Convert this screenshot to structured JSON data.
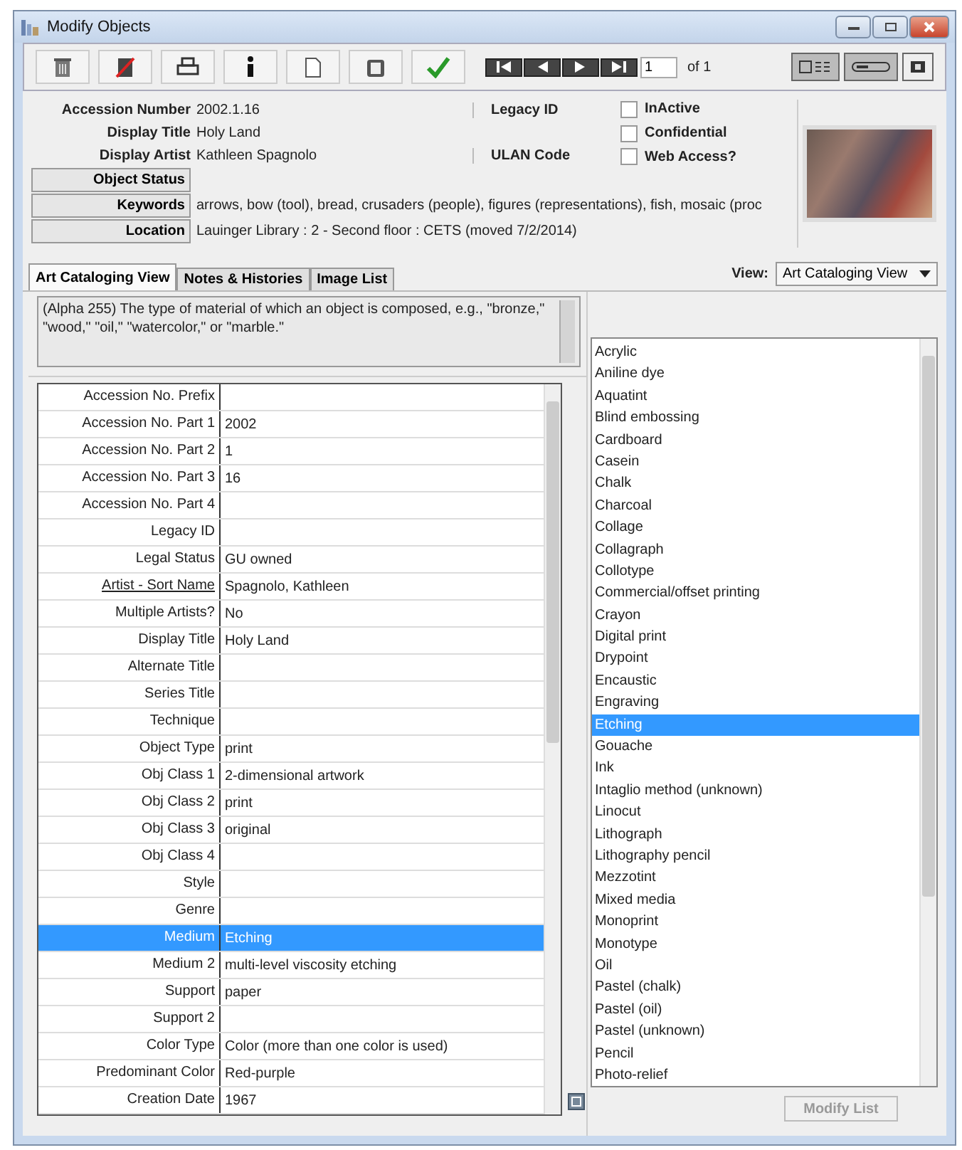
{
  "window": {
    "title": "Modify Objects"
  },
  "pager": {
    "page": "1",
    "of": "of 1"
  },
  "header": {
    "fields": [
      {
        "label": "Accession Number",
        "value": "2002.1.16"
      },
      {
        "label": "Display Title",
        "value": "Holy Land"
      },
      {
        "label": "Display Artist",
        "value": "Kathleen Spagnolo"
      }
    ],
    "side_fields": [
      {
        "label": "Legacy ID"
      },
      {
        "label": "ULAN Code"
      }
    ],
    "checkboxes": [
      {
        "label": "InActive",
        "checked": false
      },
      {
        "label": "Confidential",
        "checked": false
      },
      {
        "label": "Web Access?",
        "checked": false
      }
    ],
    "button_fields": [
      {
        "label": "Object Status"
      },
      {
        "label": "Keywords",
        "value": "arrows, bow (tool), bread, crusaders (people), figures (representations), fish, mosaic (proc"
      },
      {
        "label": "Location",
        "value": "Lauinger Library : 2 - Second floor : CETS (moved 7/2/2014)"
      }
    ]
  },
  "tabs": [
    {
      "label": "Art Cataloging View",
      "selected": true
    },
    {
      "label": "Notes & Histories",
      "selected": false
    },
    {
      "label": "Image List",
      "selected": false
    }
  ],
  "view": {
    "label": "View:",
    "value": "Art Cataloging View"
  },
  "description": "(Alpha 255) The type of material of which an object is composed, e.g., \"bronze,\" \"wood,\" \"oil,\" \"watercolor,\" or \"marble.\"",
  "table": {
    "rows": [
      {
        "label": "Accession No. Prefix",
        "link": false,
        "selected": false
      },
      {
        "label": "Accession No. Part 1",
        "value": "2002",
        "link": false,
        "selected": false
      },
      {
        "label": "Accession No. Part 2",
        "value": "1",
        "link": false,
        "selected": false
      },
      {
        "label": "Accession No. Part 3",
        "value": "16",
        "link": false,
        "selected": false
      },
      {
        "label": "Accession No. Part 4",
        "link": false,
        "selected": false
      },
      {
        "label": "Legacy ID",
        "link": false,
        "selected": false
      },
      {
        "label": "Legal Status",
        "value": "GU owned",
        "link": false,
        "selected": false
      },
      {
        "label": "Artist - Sort Name",
        "value": "Spagnolo, Kathleen",
        "link": true,
        "selected": false
      },
      {
        "label": "Multiple Artists?",
        "value": "No",
        "link": false,
        "selected": false
      },
      {
        "label": "Display Title",
        "value": "Holy Land",
        "link": false,
        "selected": false
      },
      {
        "label": "Alternate Title",
        "link": false,
        "selected": false
      },
      {
        "label": "Series Title",
        "link": false,
        "selected": false
      },
      {
        "label": "Technique",
        "link": false,
        "selected": false
      },
      {
        "label": "Object Type",
        "value": "print",
        "link": false,
        "selected": false
      },
      {
        "label": "Obj Class 1",
        "value": "2-dimensional artwork",
        "link": false,
        "selected": false
      },
      {
        "label": "Obj Class 2",
        "value": "print",
        "link": false,
        "selected": false
      },
      {
        "label": "Obj Class 3",
        "value": "original",
        "link": false,
        "selected": false
      },
      {
        "label": "Obj Class 4",
        "link": false,
        "selected": false
      },
      {
        "label": "Style",
        "link": false,
        "selected": false
      },
      {
        "label": "Genre",
        "link": false,
        "selected": false
      },
      {
        "label": "Medium",
        "value": "Etching",
        "link": false,
        "selected": true
      },
      {
        "label": "Medium 2",
        "value": "multi-level viscosity etching",
        "link": false,
        "selected": false
      },
      {
        "label": "Support",
        "value": "paper",
        "link": false,
        "selected": false
      },
      {
        "label": "Support 2",
        "link": false,
        "selected": false
      },
      {
        "label": "Color Type",
        "value": "Color (more than one color is used)",
        "link": false,
        "selected": false
      },
      {
        "label": "Predominant Color",
        "value": "Red-purple",
        "link": false,
        "selected": false
      },
      {
        "label": "Creation Date",
        "value": "1967",
        "link": false,
        "selected": false
      }
    ]
  },
  "materials": {
    "items": [
      {
        "label": "Acrylic",
        "selected": false
      },
      {
        "label": "Aniline dye",
        "selected": false
      },
      {
        "label": "Aquatint",
        "selected": false
      },
      {
        "label": "Blind embossing",
        "selected": false
      },
      {
        "label": "Cardboard",
        "selected": false
      },
      {
        "label": "Casein",
        "selected": false
      },
      {
        "label": "Chalk",
        "selected": false
      },
      {
        "label": "Charcoal",
        "selected": false
      },
      {
        "label": "Collage",
        "selected": false
      },
      {
        "label": "Collagraph",
        "selected": false
      },
      {
        "label": "Collotype",
        "selected": false
      },
      {
        "label": "Commercial/offset printing",
        "selected": false
      },
      {
        "label": "Crayon",
        "selected": false
      },
      {
        "label": "Digital print",
        "selected": false
      },
      {
        "label": "Drypoint",
        "selected": false
      },
      {
        "label": "Encaustic",
        "selected": false
      },
      {
        "label": "Engraving",
        "selected": false
      },
      {
        "label": "Etching",
        "selected": true
      },
      {
        "label": "Gouache",
        "selected": false
      },
      {
        "label": "Ink",
        "selected": false
      },
      {
        "label": "Intaglio method (unknown)",
        "selected": false
      },
      {
        "label": "Linocut",
        "selected": false
      },
      {
        "label": "Lithograph",
        "selected": false
      },
      {
        "label": "Lithography pencil",
        "selected": false
      },
      {
        "label": "Mezzotint",
        "selected": false
      },
      {
        "label": "Mixed media",
        "selected": false
      },
      {
        "label": "Monoprint",
        "selected": false
      },
      {
        "label": "Monotype",
        "selected": false
      },
      {
        "label": "Oil",
        "selected": false
      },
      {
        "label": "Pastel (chalk)",
        "selected": false
      },
      {
        "label": "Pastel (oil)",
        "selected": false
      },
      {
        "label": "Pastel (unknown)",
        "selected": false
      },
      {
        "label": "Pencil",
        "selected": false
      },
      {
        "label": "Photo-relief",
        "selected": false
      }
    ],
    "button": "Modify List"
  }
}
